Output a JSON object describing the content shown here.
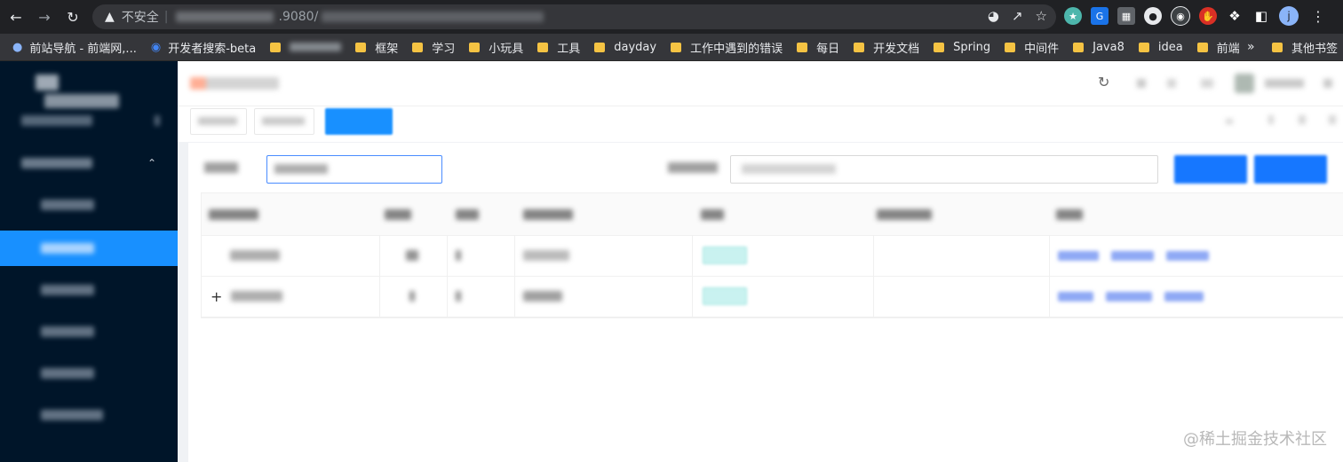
{
  "browser": {
    "back_icon": "arrow-left-icon",
    "forward_icon": "arrow-right-icon",
    "reload_icon": "reload-icon",
    "security_label": "不安全",
    "url_visible": ".9080/",
    "avatar_letter": "j"
  },
  "bookmarks": {
    "items": [
      {
        "label": "前站导航 - 前端网,..."
      },
      {
        "label": "开发者搜索-beta"
      },
      {
        "label": ""
      },
      {
        "label": "框架"
      },
      {
        "label": "学习"
      },
      {
        "label": "小玩具"
      },
      {
        "label": "工具"
      },
      {
        "label": "dayday"
      },
      {
        "label": "工作中遇到的错误"
      },
      {
        "label": "每日"
      },
      {
        "label": "开发文档"
      },
      {
        "label": "Spring"
      },
      {
        "label": "中间件"
      },
      {
        "label": "Java8"
      },
      {
        "label": "idea"
      },
      {
        "label": "前端"
      }
    ],
    "more_label": "»",
    "other_label": "其他书签"
  },
  "table": {
    "rows": [
      {
        "expand": ""
      },
      {
        "expand": "+"
      }
    ]
  },
  "watermark": "@稀土掘金技术社区",
  "colors": {
    "sidebar_bg": "#001529",
    "sidebar_active": "#1890ff",
    "primary": "#1677ff",
    "tag_bg": "#c9f2f0"
  }
}
